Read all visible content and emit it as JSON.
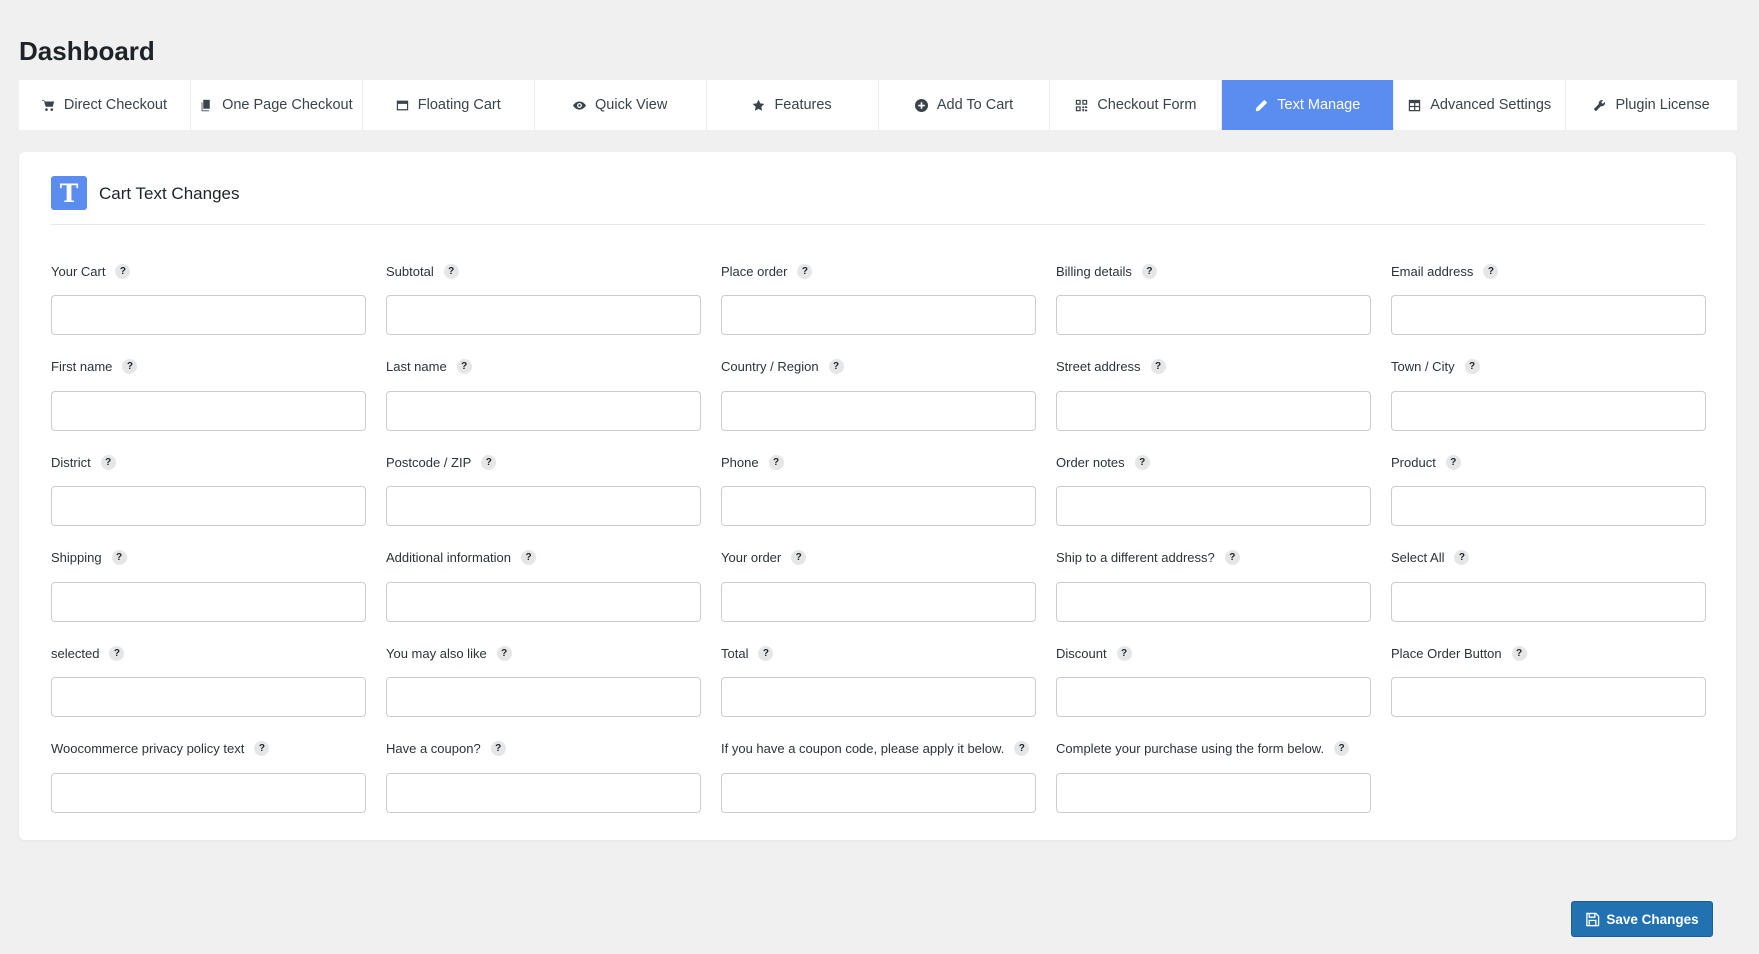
{
  "page": {
    "title": "Dashboard"
  },
  "tabs": [
    {
      "label": "Direct Checkout",
      "icon": "cart-icon",
      "active": false
    },
    {
      "label": "One Page Checkout",
      "icon": "copy-icon",
      "active": false
    },
    {
      "label": "Floating Cart",
      "icon": "window-icon",
      "active": false
    },
    {
      "label": "Quick View",
      "icon": "eye-icon",
      "active": false
    },
    {
      "label": "Features",
      "icon": "star-icon",
      "active": false
    },
    {
      "label": "Add To Cart",
      "icon": "plus-circle-icon",
      "active": false
    },
    {
      "label": "Checkout Form",
      "icon": "form-icon",
      "active": false
    },
    {
      "label": "Text Manage",
      "icon": "pencil-icon",
      "active": true
    },
    {
      "label": "Advanced Settings",
      "icon": "table-icon",
      "active": false
    },
    {
      "label": "Plugin License",
      "icon": "wrench-icon",
      "active": false
    }
  ],
  "section": {
    "title": "Cart Text Changes",
    "icon_letter": "T"
  },
  "fields": [
    {
      "label": "Your Cart",
      "value": ""
    },
    {
      "label": "Subtotal",
      "value": ""
    },
    {
      "label": "Place order",
      "value": ""
    },
    {
      "label": "Billing details",
      "value": ""
    },
    {
      "label": "Email address",
      "value": ""
    },
    {
      "label": "First name",
      "value": ""
    },
    {
      "label": "Last name",
      "value": ""
    },
    {
      "label": "Country / Region",
      "value": ""
    },
    {
      "label": "Street address",
      "value": ""
    },
    {
      "label": "Town / City",
      "value": ""
    },
    {
      "label": "District",
      "value": ""
    },
    {
      "label": "Postcode / ZIP",
      "value": ""
    },
    {
      "label": "Phone",
      "value": ""
    },
    {
      "label": "Order notes",
      "value": ""
    },
    {
      "label": "Product",
      "value": ""
    },
    {
      "label": "Shipping",
      "value": ""
    },
    {
      "label": "Additional information",
      "value": ""
    },
    {
      "label": "Your order",
      "value": ""
    },
    {
      "label": "Ship to a different address?",
      "value": ""
    },
    {
      "label": "Select All",
      "value": ""
    },
    {
      "label": "selected",
      "value": ""
    },
    {
      "label": "You may also like",
      "value": ""
    },
    {
      "label": "Total",
      "value": ""
    },
    {
      "label": "Discount",
      "value": ""
    },
    {
      "label": "Place Order Button",
      "value": ""
    },
    {
      "label": "Woocommerce privacy policy text",
      "value": ""
    },
    {
      "label": "Have a coupon?",
      "value": ""
    },
    {
      "label": "If you have a coupon code, please apply it below.",
      "value": ""
    },
    {
      "label": "Complete your purchase using the form below.",
      "value": ""
    }
  ],
  "help_glyph": "?",
  "save_button": {
    "label": "Save Changes",
    "icon": "floppy-disk-icon"
  },
  "colors": {
    "accent": "#5b8cf0",
    "button": "#2271b1",
    "background": "#f0f0f1"
  }
}
